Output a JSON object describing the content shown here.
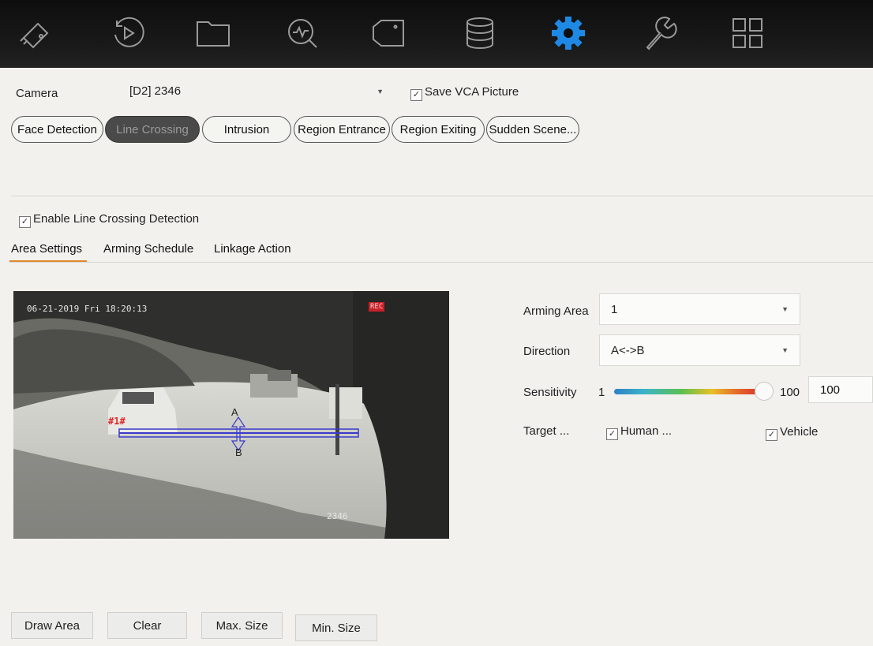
{
  "toolbar": {
    "icons": [
      "live-view-icon",
      "playback-icon",
      "file-icon",
      "search-icon",
      "camera-icon",
      "storage-icon",
      "settings-icon",
      "maintenance-icon",
      "menu-grid-icon"
    ],
    "active_color": "#1e88e5",
    "icon_color": "#9a9a9a"
  },
  "camera": {
    "label": "Camera",
    "value": "[D2] 2346",
    "save_vca_label": "Save VCA Picture",
    "save_vca_checked": true
  },
  "detection_tabs": [
    {
      "label": "Face Detection"
    },
    {
      "label": "Line Crossing",
      "active": true
    },
    {
      "label": "Intrusion"
    },
    {
      "label": "Region Entrance"
    },
    {
      "label": "Region Exiting"
    },
    {
      "label": "Sudden Scene..."
    }
  ],
  "enable": {
    "label": "Enable Line Crossing Detection",
    "checked": true
  },
  "settings_tabs": [
    {
      "label": "Area Settings",
      "active": true
    },
    {
      "label": "Arming Schedule"
    },
    {
      "label": "Linkage Action"
    }
  ],
  "video": {
    "timestamp": "06-21-2019 Fri 18:20:13",
    "channel_name": "2346",
    "line_id": "#1#",
    "point_a": "A",
    "point_b": "B",
    "rec_indicator": "REC"
  },
  "form": {
    "arming_area": {
      "label": "Arming Area",
      "value": "1"
    },
    "direction": {
      "label": "Direction",
      "value": "A<->B"
    },
    "sensitivity": {
      "label": "Sensitivity",
      "min": "1",
      "max": "100",
      "value": "100",
      "level": 1.0
    },
    "target": {
      "label": "Target ...",
      "human": "Human ...",
      "human_checked": true,
      "vehicle": "Vehicle",
      "vehicle_checked": true
    }
  },
  "buttons": {
    "draw_area": "Draw Area",
    "clear": "Clear",
    "max_size": "Max. Size",
    "min_size": "Min. Size"
  }
}
